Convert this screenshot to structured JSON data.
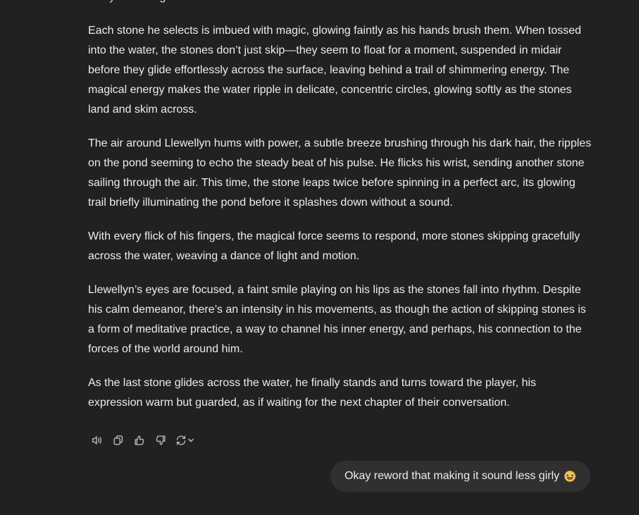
{
  "assistant": {
    "paragraphs": [
      "deftly skimming stones across the surface.",
      "Each stone he selects is imbued with magic, glowing faintly as his hands brush them. When tossed into the water, the stones don’t just skip—they seem to float for a moment, suspended in midair before they glide effortlessly across the surface, leaving behind a trail of shimmering energy. The magical energy makes the water ripple in delicate, concentric circles, glowing softly as the stones land and skim across.",
      "The air around Llewellyn hums with power, a subtle breeze brushing through his dark hair, the ripples on the pond seeming to echo the steady beat of his pulse. He flicks his wrist, sending another stone sailing through the air. This time, the stone leaps twice before spinning in a perfect arc, its glowing trail briefly illuminating the pond before it splashes down without a sound.",
      "With every flick of his fingers, the magical force seems to respond, more stones skipping gracefully across the water, weaving a dance of light and motion.",
      "Llewellyn’s eyes are focused, a faint smile playing on his lips as the stones fall into rhythm. Despite his calm demeanor, there’s an intensity in his movements, as though the action of skipping stones is a form of meditative practice, a way to channel his inner energy, and perhaps, his connection to the forces of the world around him.",
      "As the last stone glides across the water, he finally stands and turns toward the player, his expression warm but guarded, as if waiting for the next chapter of their conversation."
    ]
  },
  "actions": {
    "icons": [
      "speaker-icon",
      "copy-icon",
      "thumbs-up-icon",
      "thumbs-down-icon",
      "regenerate-icon",
      "chevron-down-icon"
    ]
  },
  "user": {
    "message": "Okay reword that making it sound less girly",
    "emoji": "😂"
  },
  "colors": {
    "background": "#212121",
    "text": "#ececec",
    "icon": "#b4b4b4",
    "bubble": "#303030"
  }
}
